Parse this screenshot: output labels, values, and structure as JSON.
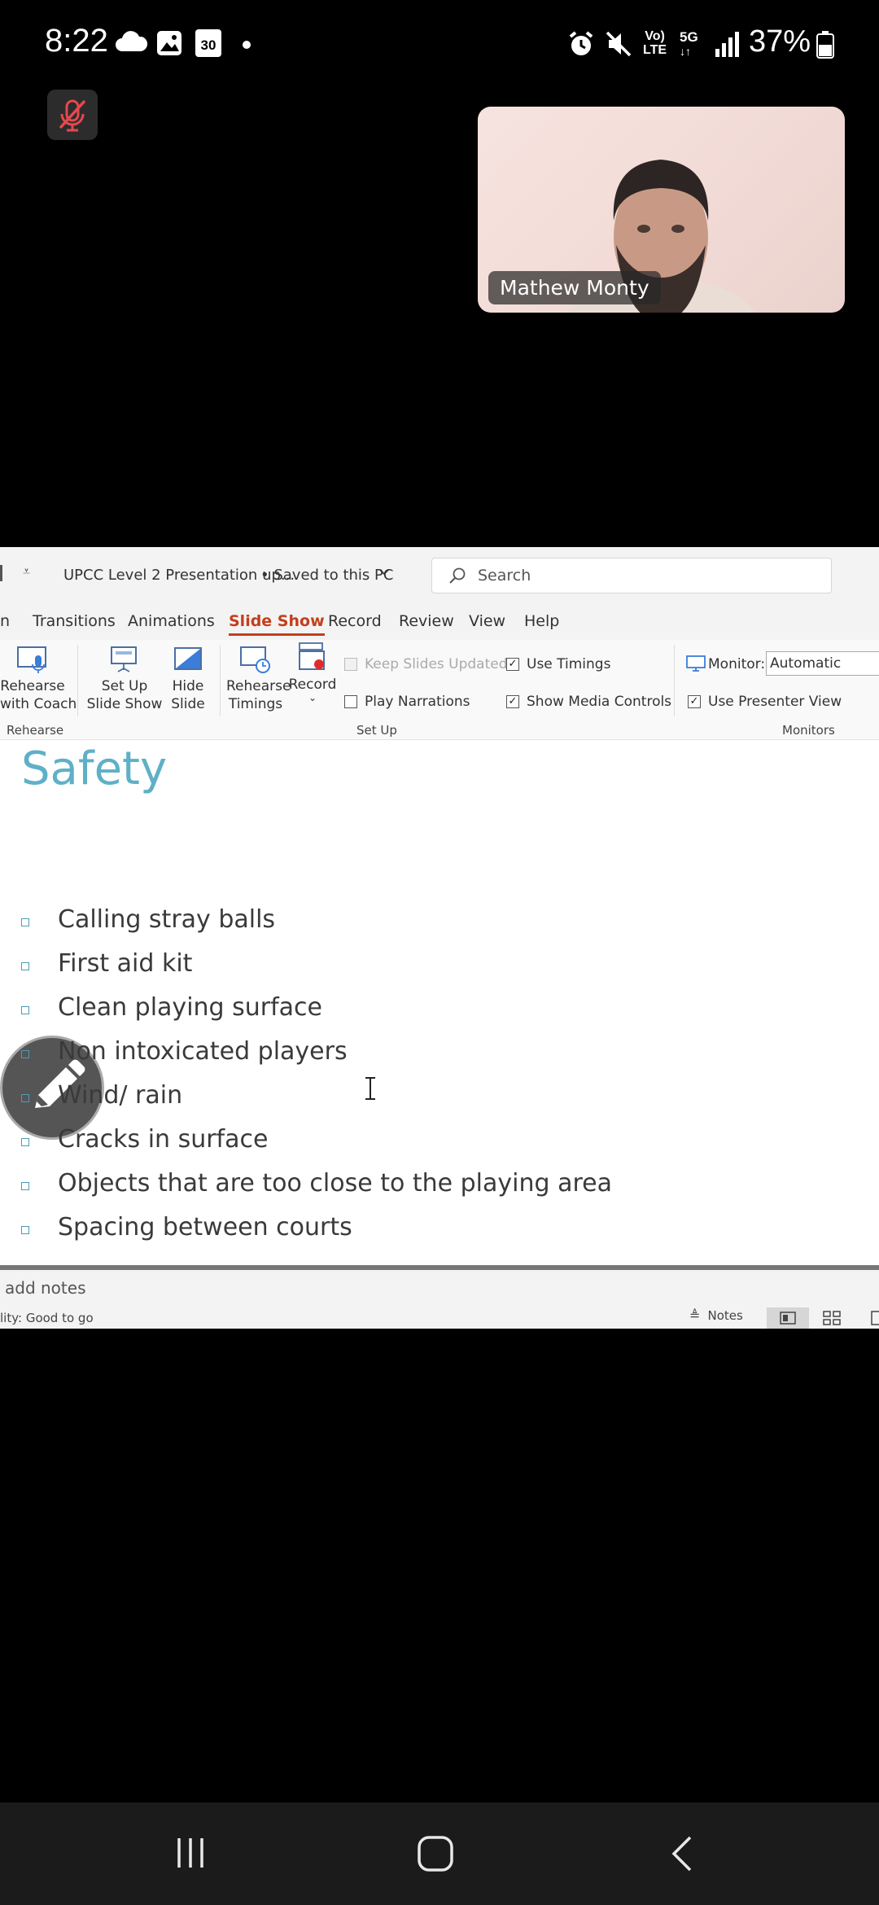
{
  "status": {
    "time": "8:22",
    "calendar_day": "30",
    "network_top": "Vo)",
    "network_bottom": "LTE",
    "five_g": "5G",
    "battery": "37%"
  },
  "video": {
    "participant_name": "Mathew Monty"
  },
  "ppt": {
    "doc_title": "UPCC Level 2 Presentation up...",
    "save_status": "• Saved to this PC",
    "search_placeholder": "Search",
    "tabs": [
      "n",
      "Transitions",
      "Animations",
      "Slide Show",
      "Record",
      "Review",
      "View",
      "Help"
    ],
    "active_tab": "Slide Show",
    "ribbon": {
      "rehearse_coach": [
        "Rehearse",
        "with Coach"
      ],
      "setup_slideshow": [
        "Set Up",
        "Slide Show"
      ],
      "hide_slide": [
        "Hide",
        "Slide"
      ],
      "rehearse_timings": [
        "Rehearse",
        "Timings"
      ],
      "record": "Record",
      "keep_slides_updated": "Keep Slides Updated",
      "play_narrations": "Play Narrations",
      "use_timings": "Use Timings",
      "show_media_controls": "Show Media Controls",
      "monitor_label": "Monitor:",
      "monitor_value": "Automatic",
      "use_presenter_view": "Use Presenter View",
      "group_rehearse": "Rehearse",
      "group_setup": "Set Up",
      "group_monitors": "Monitors"
    },
    "slide": {
      "title": "Safety",
      "bullets": [
        "Calling stray balls",
        "First aid kit",
        "Clean playing surface",
        "Non intoxicated players",
        "Wind/ rain",
        "Cracks in surface",
        "Objects that are too close to the playing area",
        "Spacing between courts"
      ]
    },
    "notes_placeholder": "add notes",
    "accessibility_status": "lity: Good to go",
    "notes_button": "Notes"
  }
}
